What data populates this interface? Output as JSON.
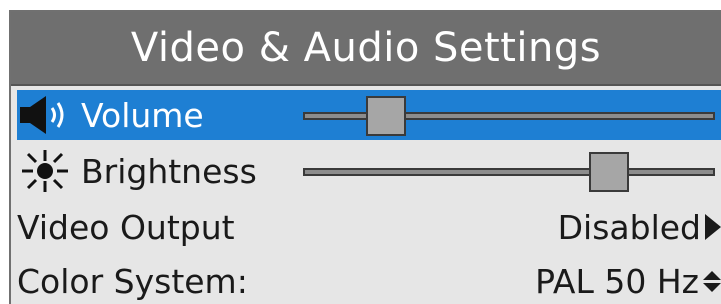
{
  "window": {
    "title": "Video & Audio Settings"
  },
  "settings": {
    "volume": {
      "label": "Volume",
      "icon": "speaker-icon",
      "level_percent": 17
    },
    "brightness": {
      "label": "Brightness",
      "icon": "sun-icon",
      "level_percent": 77
    },
    "video_output": {
      "label": "Video Output",
      "value": "Disabled",
      "icon": "right-arrow-icon"
    },
    "color_system": {
      "label": "Color System:",
      "value": "PAL 50 Hz",
      "icon": "up-down-arrows-icon"
    }
  },
  "colors": {
    "selection": "#1e7fd3",
    "title_bar": "#6f6f6f",
    "panel_bg": "#e6e6e6"
  }
}
